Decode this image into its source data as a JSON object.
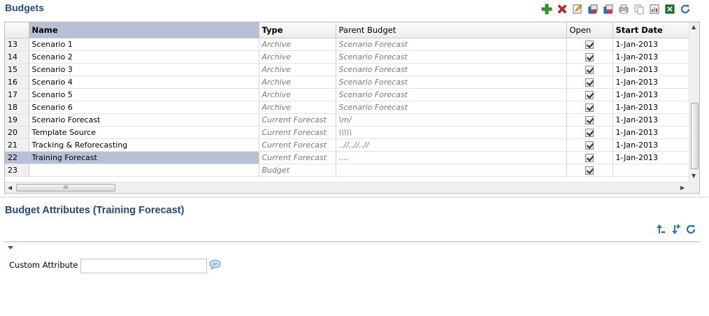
{
  "budgets": {
    "title": "Budgets",
    "toolbar_icons": [
      "add-icon",
      "delete-icon",
      "edit-icon",
      "copy-budget-icon",
      "paste-budget-icon",
      "print-icon",
      "duplicate-icon",
      "report-icon",
      "excel-export-icon",
      "refresh-icon"
    ],
    "columns": [
      "",
      "Name",
      "Type",
      "Parent Budget",
      "Open",
      "Start Date"
    ],
    "rows": [
      {
        "num": "13",
        "name": "Scenario 1",
        "type": "Archive",
        "parent": "Scenario Forecast",
        "open": true,
        "start": "1-Jan-2013"
      },
      {
        "num": "14",
        "name": "Scenario 2",
        "type": "Archive",
        "parent": "Scenario Forecast",
        "open": true,
        "start": "1-Jan-2013"
      },
      {
        "num": "15",
        "name": "Scenario 3",
        "type": "Archive",
        "parent": "Scenario Forecast",
        "open": true,
        "start": "1-Jan-2013"
      },
      {
        "num": "16",
        "name": "Scenario 4",
        "type": "Archive",
        "parent": "Scenario Forecast",
        "open": true,
        "start": "1-Jan-2013"
      },
      {
        "num": "17",
        "name": "Scenario 5",
        "type": "Archive",
        "parent": "Scenario Forecast",
        "open": true,
        "start": "1-Jan-2013"
      },
      {
        "num": "18",
        "name": "Scenario 6",
        "type": "Archive",
        "parent": "Scenario Forecast",
        "open": true,
        "start": "1-Jan-2013"
      },
      {
        "num": "19",
        "name": "Scenario Forecast",
        "type": "Current Forecast",
        "parent": "\\m/",
        "open": true,
        "start": "1-Jan-2013"
      },
      {
        "num": "20",
        "name": "Template Source",
        "type": "Current Forecast",
        "parent": "\\\\\\\\\\",
        "open": true,
        "start": "1-Jan-2013"
      },
      {
        "num": "21",
        "name": "Tracking & Reforecasting",
        "type": "Current Forecast",
        "parent": "..//..//..//",
        "open": true,
        "start": "1-Jan-2013"
      },
      {
        "num": "22",
        "name": "Training Forecast",
        "type": "Current Forecast",
        "parent": "....",
        "open": true,
        "start": "1-Jan-2013",
        "selected": true
      },
      {
        "num": "23",
        "name": "",
        "type": "Budget",
        "parent": "",
        "open": true,
        "start": ""
      }
    ],
    "hscroll_grip": "III"
  },
  "attributes": {
    "title": "Budget Attributes (Training Forecast)",
    "toolbar_icons": [
      "move-up-icon",
      "add-attribute-icon",
      "refresh-icon"
    ],
    "custom_label": "Custom Attribute",
    "custom_value": ""
  },
  "colors": {
    "title": "#1f4a7a",
    "selection": "#b8c0d6",
    "add": "#2e9b2e",
    "delete": "#d42020"
  }
}
